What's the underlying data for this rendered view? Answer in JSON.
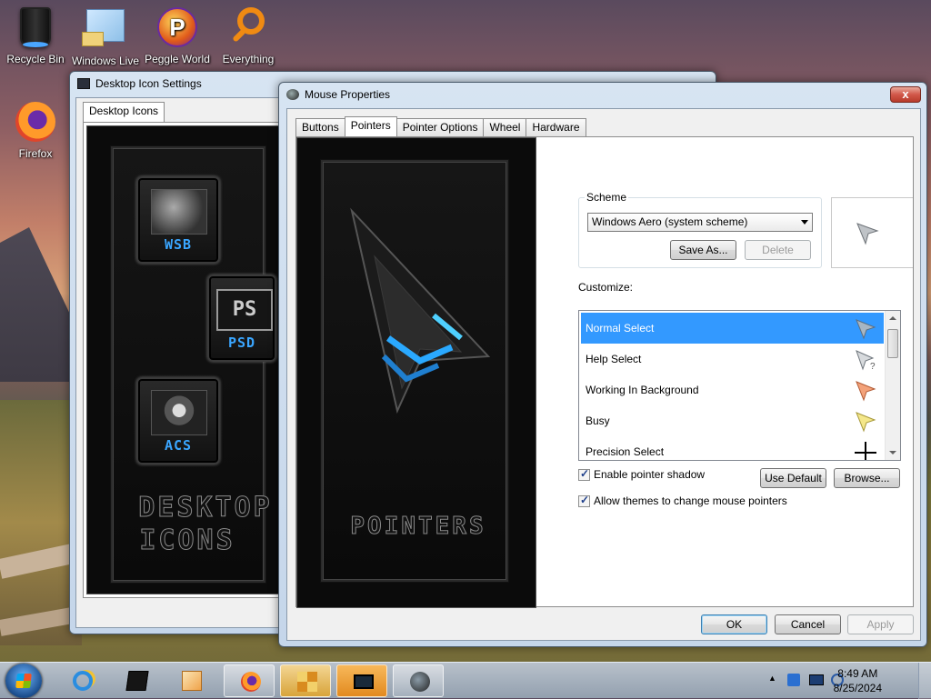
{
  "desktop": {
    "icons": [
      {
        "label": "Recycle Bin",
        "icon": "recycle-bin-icon"
      },
      {
        "label": "Windows Live",
        "icon": "windows-live-icon"
      },
      {
        "label": "Peggle World",
        "icon": "peggle-icon"
      },
      {
        "label": "Everything",
        "icon": "everything-search-icon"
      },
      {
        "label": "Firefox",
        "icon": "firefox-icon"
      }
    ]
  },
  "desktop_icon_settings": {
    "title": "Desktop Icon Settings",
    "tab": "Desktop Icons",
    "art": {
      "tile1": "WSB",
      "tile2": "PSD",
      "tile2_inner": "PS",
      "tile3": "ACS",
      "line1": "DESKTOP",
      "line2": "ICONS"
    }
  },
  "mouse_properties": {
    "title": "Mouse Properties",
    "close_label": "x",
    "tabs": [
      "Buttons",
      "Pointers",
      "Pointer Options",
      "Wheel",
      "Hardware"
    ],
    "active_tab": "Pointers",
    "art_label": "POINTERS",
    "scheme": {
      "label": "Scheme",
      "selected": "Windows Aero (system scheme)",
      "save_as": "Save As...",
      "delete": "Delete"
    },
    "customize_label": "Customize:",
    "pointers": [
      {
        "name": "Normal Select",
        "selected": true
      },
      {
        "name": "Help Select",
        "selected": false
      },
      {
        "name": "Working In Background",
        "selected": false
      },
      {
        "name": "Busy",
        "selected": false
      },
      {
        "name": "Precision Select",
        "selected": false
      }
    ],
    "enable_shadow": {
      "label": "Enable pointer shadow",
      "checked": true
    },
    "allow_themes": {
      "label": "Allow themes to change mouse pointers",
      "checked": true
    },
    "use_default": "Use Default",
    "browse": "Browse...",
    "ok": "OK",
    "cancel": "Cancel",
    "apply": "Apply"
  },
  "taskbar": {
    "clock_time": "8:49 AM",
    "clock_date": "8/25/2024",
    "tray_arrow": "▲"
  },
  "colors": {
    "selection": "#3399ff",
    "accent_blue": "#3aa6ff"
  }
}
